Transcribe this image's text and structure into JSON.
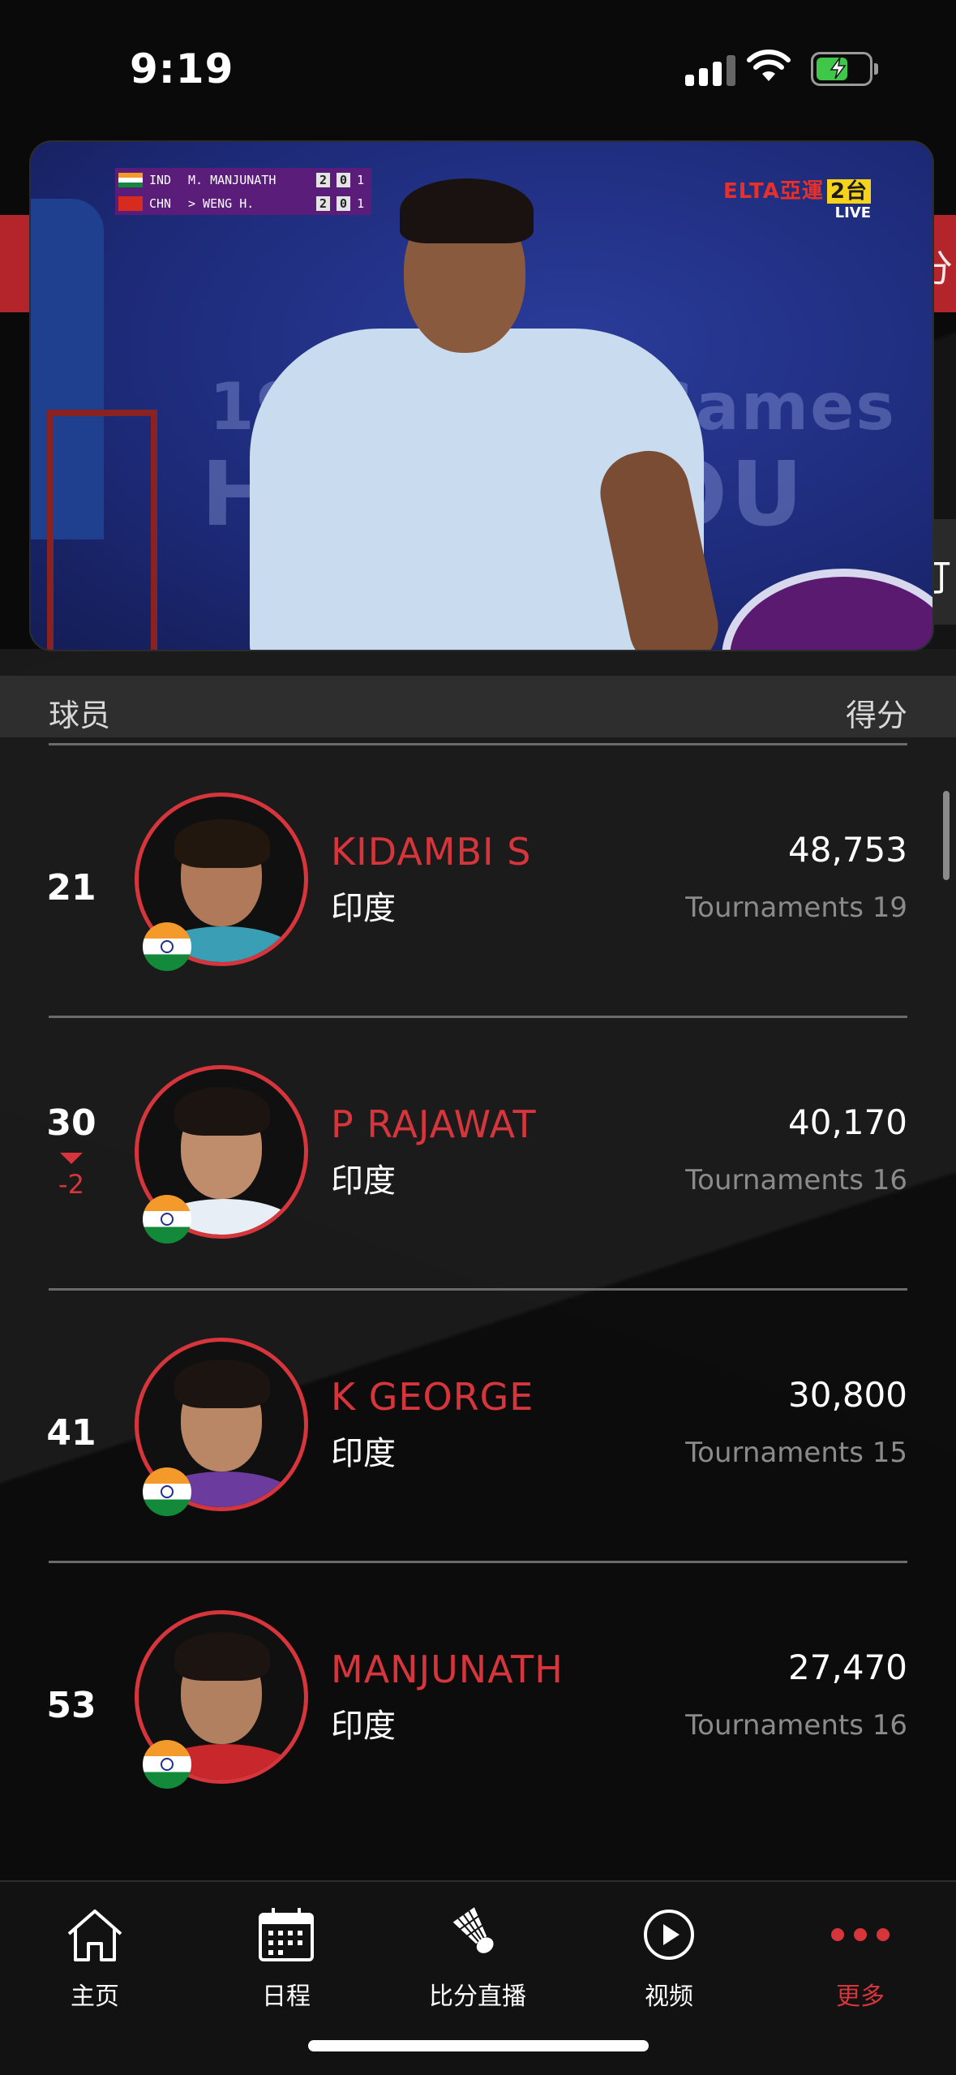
{
  "status_bar": {
    "time": "9:19"
  },
  "video": {
    "score_rows": [
      {
        "country": "IND",
        "name": "M. MANJUNATH",
        "s1": "2",
        "s2": "0",
        "s3": "1"
      },
      {
        "country": "CHN",
        "name": "> WENG H.",
        "s1": "2",
        "s2": "0",
        "s3": "1"
      }
    ],
    "broadcaster": "ELTA",
    "broadcaster_cn": "亞運",
    "channel": "2台",
    "live": "LIVE",
    "watermark_line1": "19th Asian Games",
    "watermark_line2": "HANGZHOU"
  },
  "side_tabs": {
    "right_top": "分",
    "right_mid": "打"
  },
  "table_header": {
    "player": "球员",
    "score": "得分"
  },
  "players": [
    {
      "rank": "21",
      "name": "KIDAMBI S",
      "country": "印度",
      "points": "48,753",
      "tournaments": "Tournaments 19",
      "rank_change": null
    },
    {
      "rank": "30",
      "name": "P RAJAWAT",
      "country": "印度",
      "points": "40,170",
      "tournaments": "Tournaments 16",
      "rank_change": "-2"
    },
    {
      "rank": "41",
      "name": "K GEORGE",
      "country": "印度",
      "points": "30,800",
      "tournaments": "Tournaments 15",
      "rank_change": null
    },
    {
      "rank": "53",
      "name": "MANJUNATH",
      "country": "印度",
      "points": "27,470",
      "tournaments": "Tournaments 16",
      "rank_change": null
    }
  ],
  "tabs": [
    {
      "label": "主页",
      "icon": "home-icon"
    },
    {
      "label": "日程",
      "icon": "calendar-icon"
    },
    {
      "label": "比分直播",
      "icon": "shuttlecock-icon"
    },
    {
      "label": "视频",
      "icon": "play-icon"
    },
    {
      "label": "更多",
      "icon": "more-dots-icon",
      "active": true
    }
  ],
  "colors": {
    "accent": "#d6353b",
    "background": "#141414",
    "header_bg": "#2e2e2e"
  }
}
